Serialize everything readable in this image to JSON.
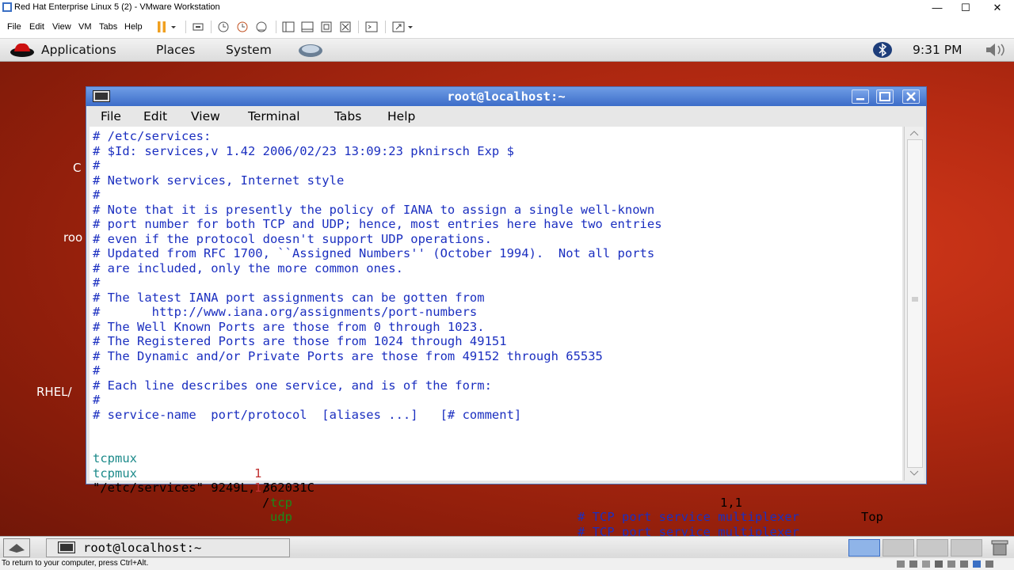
{
  "vmware": {
    "title": "Red Hat Enterprise Linux 5 (2) - VMware Workstation",
    "menu": [
      "File",
      "Edit",
      "View",
      "VM",
      "Tabs",
      "Help"
    ],
    "window_controls": {
      "minimize": "—",
      "maximize": "☐",
      "close": "✕"
    },
    "status_text": "To return to your computer, press Ctrl+Alt."
  },
  "gnome_top_panel": {
    "menus": [
      "Applications",
      "Places",
      "System"
    ],
    "clock": "9:31 PM"
  },
  "desktop_icons": [
    "C",
    "roo",
    "RHEL/"
  ],
  "terminal": {
    "title": "root@localhost:~",
    "menu": [
      "File",
      "Edit",
      "View",
      "Terminal",
      "Tabs",
      "Help"
    ],
    "lines": [
      "# /etc/services:",
      "# $Id: services,v 1.42 2006/02/23 13:09:23 pknirsch Exp $",
      "#",
      "# Network services, Internet style",
      "#",
      "# Note that it is presently the policy of IANA to assign a single well-known",
      "# port number for both TCP and UDP; hence, most entries here have two entries",
      "# even if the protocol doesn't support UDP operations.",
      "# Updated from RFC 1700, ``Assigned Numbers'' (October 1994).  Not all ports",
      "# are included, only the more common ones.",
      "#",
      "# The latest IANA port assignments can be gotten from",
      "#       http://www.iana.org/assignments/port-numbers",
      "# The Well Known Ports are those from 0 through 1023.",
      "# The Registered Ports are those from 1024 through 49151",
      "# The Dynamic and/or Private Ports are those from 49152 through 65535",
      "#",
      "# Each line describes one service, and is of the form:",
      "#",
      "# service-name  port/protocol  [aliases ...]   [# comment]",
      ""
    ],
    "entries": [
      {
        "service": "tcpmux",
        "port": "1",
        "proto": "tcp",
        "comment": "# TCP port service multiplexer"
      },
      {
        "service": "tcpmux",
        "port": "1",
        "proto": "udp",
        "comment": "# TCP port service multiplexer"
      }
    ],
    "status": {
      "file": "\"/etc/services\" 9249L, 362031C",
      "position": "1,1",
      "scroll": "Top"
    }
  },
  "taskbar": {
    "task_label": "root@localhost:~"
  }
}
